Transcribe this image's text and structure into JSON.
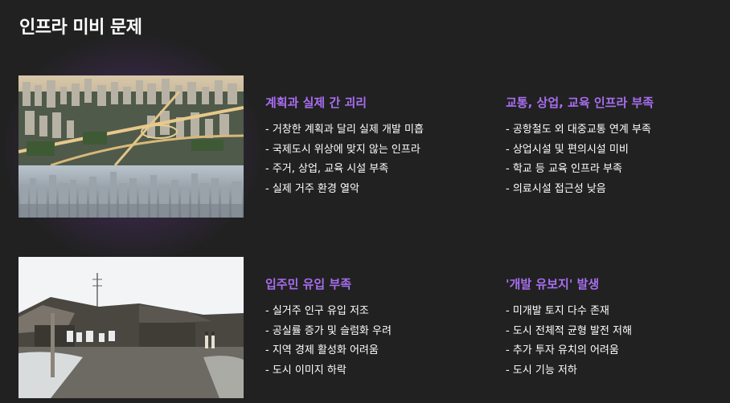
{
  "page": {
    "title": "인프라 미비 문제"
  },
  "sections": [
    {
      "title": "계획과 실제 간 괴리",
      "items": [
        "거창한 계획과 달리 실제 개발 미흡",
        "국제도시 위상에 맞지 않는 인프라",
        "주거, 상업, 교육 시설 부족",
        "실제 거주 환경 열악"
      ]
    },
    {
      "title": "교통, 상업, 교육 인프라 부족",
      "items": [
        "공항철도 외 대중교통 연계 부족",
        "상업시설 및 편의시설 미비",
        "학교 등 교육 인프라 부족",
        "의료시설 접근성 낮음"
      ]
    },
    {
      "title": "입주민 유입 부족",
      "items": [
        "실거주 인구 유입 저조",
        "공실률 증가 및 슬럼화 우려",
        "지역 경제 활성화 어려움",
        "도시 이미지 하락"
      ]
    },
    {
      "title": "'개발 유보지' 발생",
      "items": [
        "미개발 토지 다수 존재",
        "도시 전체적 균형 발전 저해",
        "추가 투자 유치의 어려움",
        "도시 기능 저하"
      ]
    }
  ],
  "colors": {
    "background": "#212121",
    "accent": "#a86ef0",
    "text": "#ffffff"
  }
}
